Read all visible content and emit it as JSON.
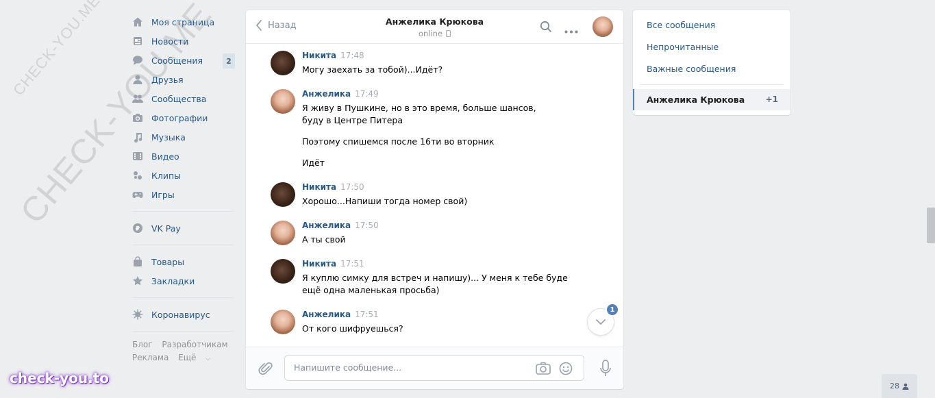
{
  "watermark": {
    "small_text": "CHECK-YOU.ME",
    "big_text": "CHECK-YOU.ME",
    "logo_text": "check-you.to"
  },
  "left_nav": {
    "items": [
      {
        "label": "Моя страница",
        "icon": "home-icon"
      },
      {
        "label": "Новости",
        "icon": "news-icon"
      },
      {
        "label": "Сообщения",
        "icon": "messages-icon",
        "badge": "2"
      },
      {
        "label": "Друзья",
        "icon": "friends-icon"
      },
      {
        "label": "Сообщества",
        "icon": "communities-icon"
      },
      {
        "label": "Фотографии",
        "icon": "camera-icon"
      },
      {
        "label": "Музыка",
        "icon": "music-icon"
      },
      {
        "label": "Видео",
        "icon": "video-icon"
      },
      {
        "label": "Клипы",
        "icon": "clips-icon"
      },
      {
        "label": "Игры",
        "icon": "gamepad-icon"
      }
    ],
    "vkpay": {
      "label": "VK Pay",
      "icon": "vkpay-icon"
    },
    "goods": {
      "label": "Товары",
      "icon": "bag-icon"
    },
    "bookmarks": {
      "label": "Закладки",
      "icon": "star-icon"
    },
    "corona": {
      "label": "Коронавирус",
      "icon": "virus-icon"
    },
    "footer": {
      "blog": "Блог",
      "developers": "Разработчикам",
      "ads": "Реклама",
      "more": "Ещё"
    }
  },
  "chat": {
    "back_label": "Назад",
    "peer_name": "Анжелика Крюкова",
    "peer_status": "online",
    "messages": [
      {
        "author": "Никита",
        "time": "17:48",
        "lines": [
          "Могу заехать за тобой)...Идёт?"
        ]
      },
      {
        "author": "Анжелика",
        "time": "17:49",
        "text1": "Я живу в Пушкине, но в это время, больше шансов, буду в Центре Питера",
        "text2": "Поэтому спишемся после 16ти во вторник",
        "text3": "Идёт"
      },
      {
        "author": "Никита",
        "time": "17:50",
        "lines": [
          "Хорошо...Напиши тогда номер свой)"
        ]
      },
      {
        "author": "Анжелика",
        "time": "17:50",
        "lines": [
          "А ты свой"
        ]
      },
      {
        "author": "Никита",
        "time": "17:51",
        "lines": [
          "Я куплю симку для встреч и напишу)... У меня к тебе буде ещё одна маленькая просьба)"
        ]
      },
      {
        "author": "Анжелика",
        "time": "17:51",
        "lines": [
          "От кого шифруешься?"
        ]
      }
    ],
    "unread_count": "1",
    "composer_placeholder": "Напишите сообщение..."
  },
  "right_panel": {
    "all": "Все сообщения",
    "unread": "Непрочитанные",
    "important": "Важные сообщения",
    "active_name": "Анжелика Крюкова",
    "active_count": "+1"
  },
  "online_count": "28",
  "colors": {
    "accent": "#5181b8",
    "link": "#2a5885",
    "bg": "#edeef0"
  }
}
